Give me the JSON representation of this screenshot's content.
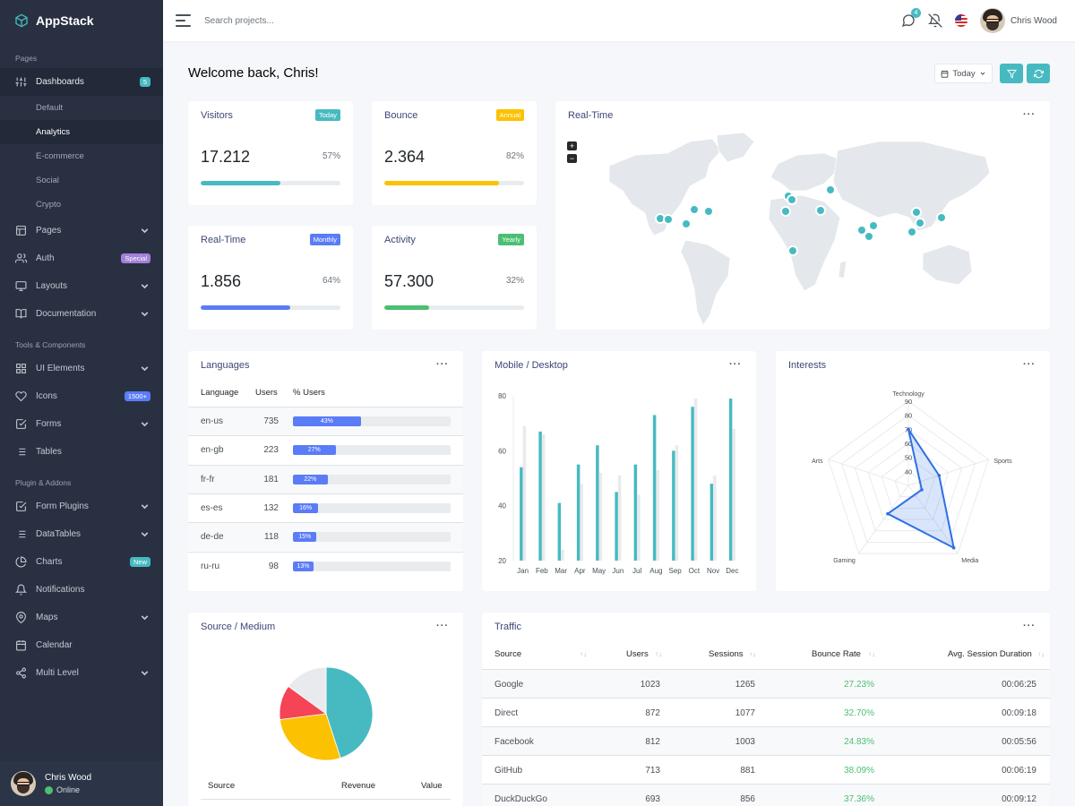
{
  "app": {
    "name": "AppStack"
  },
  "sidebar": {
    "sections": {
      "pages": "Pages",
      "tools": "Tools & Components",
      "plugins": "Plugin & Addons"
    },
    "dashboards": {
      "label": "Dashboards",
      "badge": "5"
    },
    "dashboard_items": [
      "Default",
      "Analytics",
      "E-commerce",
      "Social",
      "Crypto"
    ],
    "pages": "Pages",
    "auth": {
      "label": "Auth",
      "badge": "Special"
    },
    "layouts": "Layouts",
    "documentation": "Documentation",
    "ui_elements": "UI Elements",
    "icons": {
      "label": "Icons",
      "badge": "1500+"
    },
    "forms": "Forms",
    "tables": "Tables",
    "form_plugins": "Form Plugins",
    "datatables": "DataTables",
    "charts": {
      "label": "Charts",
      "badge": "New"
    },
    "notifications": "Notifications",
    "maps": "Maps",
    "calendar": "Calendar",
    "multi_level": "Multi Level",
    "user": {
      "name": "Chris Wood",
      "status": "Online"
    }
  },
  "topbar": {
    "search_placeholder": "Search projects...",
    "messages_count": "4",
    "user_name": "Chris Wood"
  },
  "main": {
    "welcome": "Welcome back, Chris!",
    "today_label": "Today"
  },
  "stats": [
    {
      "title": "Visitors",
      "badge": "Today",
      "value": "17.212",
      "pct": "57%",
      "progress": 0.57,
      "color": "#47bac1"
    },
    {
      "title": "Bounce",
      "badge": "Annual",
      "value": "2.364",
      "pct": "82%",
      "progress": 0.82,
      "color": "#fcc100"
    },
    {
      "title": "Real-Time",
      "badge": "Monthly",
      "value": "1.856",
      "pct": "64%",
      "progress": 0.64,
      "color": "#5b7cf7"
    },
    {
      "title": "Activity",
      "badge": "Yearly",
      "value": "57.300",
      "pct": "32%",
      "progress": 0.32,
      "color": "#4bbf73"
    }
  ],
  "realtime_map": {
    "title": "Real-Time",
    "zoom_in": "+",
    "zoom_out": "−"
  },
  "languages": {
    "title": "Languages",
    "headers": [
      "Language",
      "Users",
      "% Users"
    ],
    "rows": [
      {
        "lang": "en-us",
        "users": "735",
        "pct": "43%",
        "value": 43
      },
      {
        "lang": "en-gb",
        "users": "223",
        "pct": "27%",
        "value": 27
      },
      {
        "lang": "fr-fr",
        "users": "181",
        "pct": "22%",
        "value": 22
      },
      {
        "lang": "es-es",
        "users": "132",
        "pct": "16%",
        "value": 16
      },
      {
        "lang": "de-de",
        "users": "118",
        "pct": "15%",
        "value": 15
      },
      {
        "lang": "ru-ru",
        "users": "98",
        "pct": "13%",
        "value": 13
      }
    ]
  },
  "mobile_desktop": {
    "title": "Mobile / Desktop"
  },
  "interests": {
    "title": "Interests"
  },
  "source_medium": {
    "title": "Source / Medium",
    "headers": [
      "Source",
      "Revenue",
      "Value"
    ]
  },
  "traffic": {
    "title": "Traffic",
    "headers": [
      "Source",
      "Users",
      "Sessions",
      "Bounce Rate",
      "Avg. Session Duration"
    ],
    "rows": [
      {
        "source": "Google",
        "users": "1023",
        "sessions": "1265",
        "bounce": "27.23%",
        "duration": "00:06:25"
      },
      {
        "source": "Direct",
        "users": "872",
        "sessions": "1077",
        "bounce": "32.70%",
        "duration": "00:09:18"
      },
      {
        "source": "Facebook",
        "users": "812",
        "sessions": "1003",
        "bounce": "24.83%",
        "duration": "00:05:56"
      },
      {
        "source": "GitHub",
        "users": "713",
        "sessions": "881",
        "bounce": "38.09%",
        "duration": "00:06:19"
      },
      {
        "source": "DuckDuckGo",
        "users": "693",
        "sessions": "856",
        "bounce": "37.36%",
        "duration": "00:09:12"
      }
    ]
  },
  "chart_data": [
    {
      "type": "bar",
      "categories": [
        "Jan",
        "Feb",
        "Mar",
        "Apr",
        "May",
        "Jun",
        "Jul",
        "Aug",
        "Sep",
        "Oct",
        "Nov",
        "Dec"
      ],
      "series": [
        {
          "values": [
            54,
            67,
            41,
            55,
            62,
            45,
            55,
            73,
            60,
            76,
            48,
            79
          ]
        },
        {
          "values": [
            69,
            66,
            24,
            48,
            52,
            51,
            44,
            53,
            62,
            79,
            51,
            68
          ]
        }
      ],
      "yticks": [
        20,
        40,
        60,
        80
      ],
      "ylim": [
        20,
        80
      ],
      "colors": [
        "#47bac1",
        "#e8eaed"
      ],
      "grid": true
    },
    {
      "type": "radar",
      "axes": [
        "Technology",
        "Sports",
        "Media",
        "Gaming",
        "Arts"
      ],
      "values": [
        70,
        53,
        85,
        55,
        20
      ],
      "rticks": [
        30,
        40,
        50,
        60,
        70,
        80,
        90
      ],
      "rlim": [
        30,
        90
      ],
      "color": "#2e70e6"
    },
    {
      "type": "pie",
      "values": [
        45,
        28,
        12,
        15
      ],
      "colors": [
        "#47bac1",
        "#fcc100",
        "#f44455",
        "#e8eaed"
      ]
    }
  ]
}
